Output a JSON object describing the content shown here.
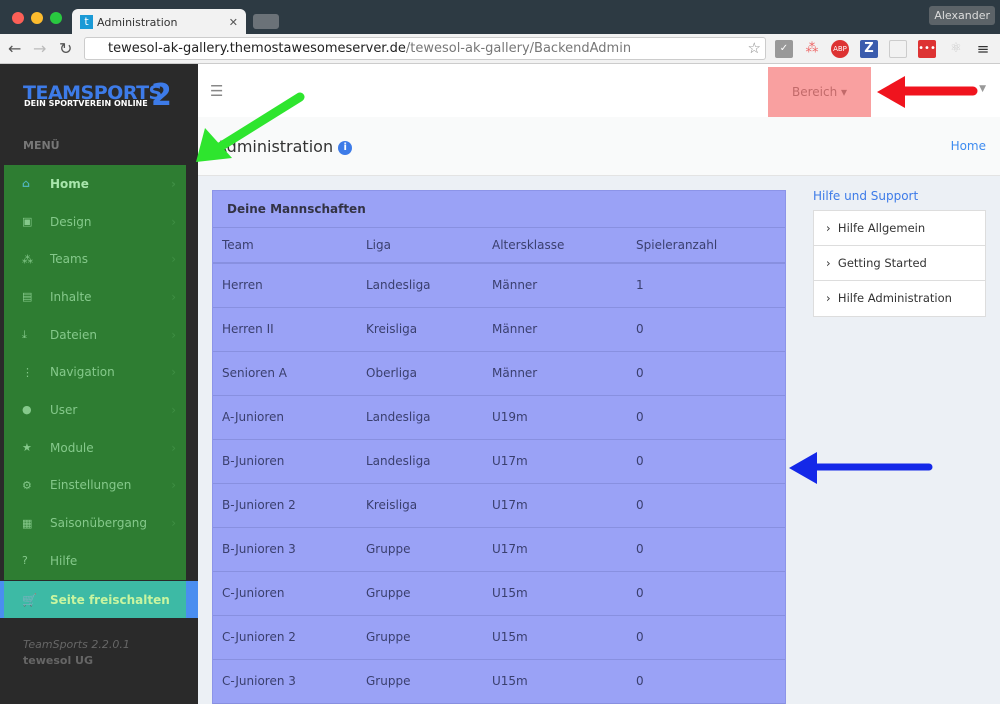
{
  "browser": {
    "tab_title": "Administration",
    "tab_favicon": "t",
    "profile": "Alexander",
    "url_host": "tewesol-ak-gallery.themostawesomeserver.de",
    "url_path": "/tewesol-ak-gallery/BackendAdmin",
    "extensions": [
      "ABP",
      "Z"
    ]
  },
  "sidebar": {
    "logo_main": "TEAMSPORTS",
    "logo_num": "2",
    "logo_sub": "DEIN SPORTVEREIN ONLINE",
    "menu_heading": "MENÜ",
    "items": [
      {
        "label": "Home",
        "icon": "⌂"
      },
      {
        "label": "Design",
        "icon": "▣"
      },
      {
        "label": "Teams",
        "icon": "⁂"
      },
      {
        "label": "Inhalte",
        "icon": "▤"
      },
      {
        "label": "Dateien",
        "icon": "⤓"
      },
      {
        "label": "Navigation",
        "icon": "⋮"
      },
      {
        "label": "User",
        "icon": "●"
      },
      {
        "label": "Module",
        "icon": "★"
      },
      {
        "label": "Einstellungen",
        "icon": "⚙"
      },
      {
        "label": "Saisonübergang",
        "icon": "▦"
      },
      {
        "label": "Hilfe",
        "icon": "?"
      }
    ],
    "active": {
      "label": "Seite freischalten",
      "icon": "🛒"
    },
    "version": "TeamSports 2.2.0.1",
    "company": "tewesol UG"
  },
  "header": {
    "bereich": "Bereich ▾"
  },
  "content": {
    "title": "Administration",
    "breadcrumb": "Home"
  },
  "teams": {
    "title": "Deine Mannschaften",
    "columns": [
      "Team",
      "Liga",
      "Altersklasse",
      "Spieleranzahl"
    ],
    "rows": [
      [
        "Herren",
        "Landesliga",
        "Männer",
        "1"
      ],
      [
        "Herren II",
        "Kreisliga",
        "Männer",
        "0"
      ],
      [
        "Senioren A",
        "Oberliga",
        "Männer",
        "0"
      ],
      [
        "A-Junioren",
        "Landesliga",
        "U19m",
        "0"
      ],
      [
        "B-Junioren",
        "Landesliga",
        "U17m",
        "0"
      ],
      [
        "B-Junioren 2",
        "Kreisliga",
        "U17m",
        "0"
      ],
      [
        "B-Junioren 3",
        "Gruppe",
        "U17m",
        "0"
      ],
      [
        "C-Junioren",
        "Gruppe",
        "U15m",
        "0"
      ],
      [
        "C-Junioren 2",
        "Gruppe",
        "U15m",
        "0"
      ],
      [
        "C-Junioren 3",
        "Gruppe",
        "U15m",
        "0"
      ]
    ]
  },
  "help": {
    "title": "Hilfe und Support",
    "links": [
      "Hilfe Allgemein",
      "Getting Started",
      "Hilfe Administration"
    ]
  },
  "colors": {
    "green_overlay": "#2e7d32",
    "table_overlay": "#9aa2f6",
    "bereich_overlay": "#f9a0a0",
    "accent": "#3d7be8"
  }
}
